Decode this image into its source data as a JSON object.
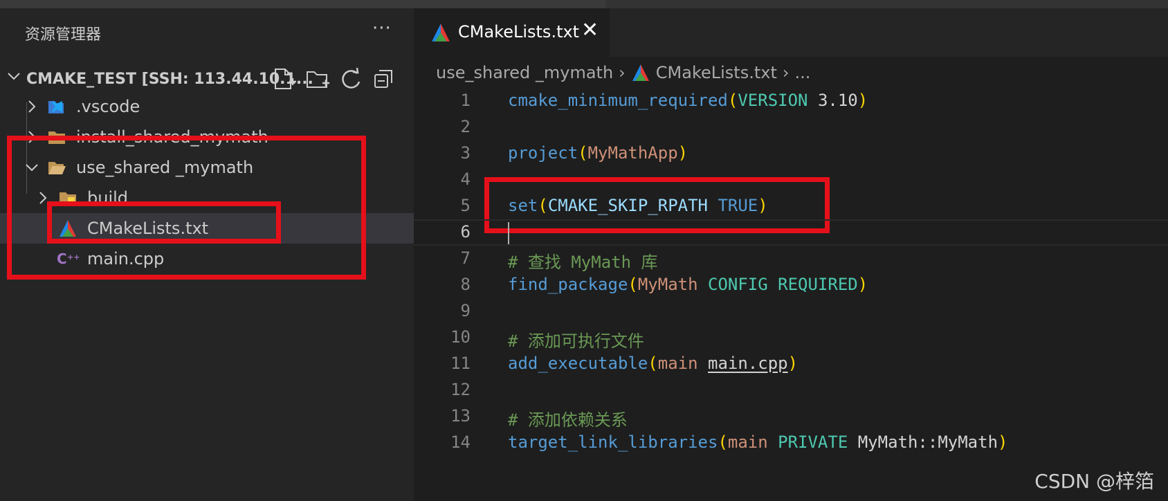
{
  "sidebar": {
    "title": "资源管理器",
    "more": "···",
    "project": "CMAKE_TEST [SSH: 113.44.10.1...",
    "items": [
      {
        "label": ".vscode"
      },
      {
        "label": "install_shared_mymath"
      },
      {
        "label": "use_shared _mymath"
      },
      {
        "label": "build"
      },
      {
        "label": "CMakeLists.txt"
      },
      {
        "label": "main.cpp"
      }
    ]
  },
  "editor": {
    "tab": {
      "label": "CMakeLists.txt",
      "close": "✕"
    },
    "breadcrumb": {
      "folder": "use_shared _mymath",
      "file": "CMakeLists.txt",
      "more": "..."
    },
    "lines": [
      {
        "n": "1"
      },
      {
        "n": "2"
      },
      {
        "n": "3"
      },
      {
        "n": "4"
      },
      {
        "n": "5"
      },
      {
        "n": "6"
      },
      {
        "n": "7"
      },
      {
        "n": "8"
      },
      {
        "n": "9"
      },
      {
        "n": "10"
      },
      {
        "n": "11"
      },
      {
        "n": "12"
      },
      {
        "n": "13"
      },
      {
        "n": "14"
      }
    ],
    "code": {
      "l1": {
        "fn": "cmake_minimum_required",
        "open": "(",
        "kw": "VERSION",
        "num": " 3.10",
        "close": ")"
      },
      "l3": {
        "fn": "project",
        "open": "(",
        "arg": "MyMathApp",
        "close": ")"
      },
      "l5": {
        "fn": "set",
        "open": "(",
        "var": "CMAKE_SKIP_RPATH",
        "kw": " TRUE",
        "close": ")"
      },
      "l7": "# 查找 MyMath 库",
      "l8": {
        "fn": "find_package",
        "open": "(",
        "arg": "MyMath",
        "kw": " CONFIG REQUIRED",
        "close": ")"
      },
      "l10": "# 添加可执行文件",
      "l11": {
        "fn": "add_executable",
        "open": "(",
        "arg": "main",
        "src": "main.cpp",
        "close": ")"
      },
      "l13": "# 添加依赖关系",
      "l14": {
        "fn": "target_link_libraries",
        "open": "(",
        "arg": "main",
        "kw": " PRIVATE",
        "lib": " MyMath::MyMath",
        "close": ")"
      }
    }
  },
  "watermark": "CSDN @梓箔"
}
